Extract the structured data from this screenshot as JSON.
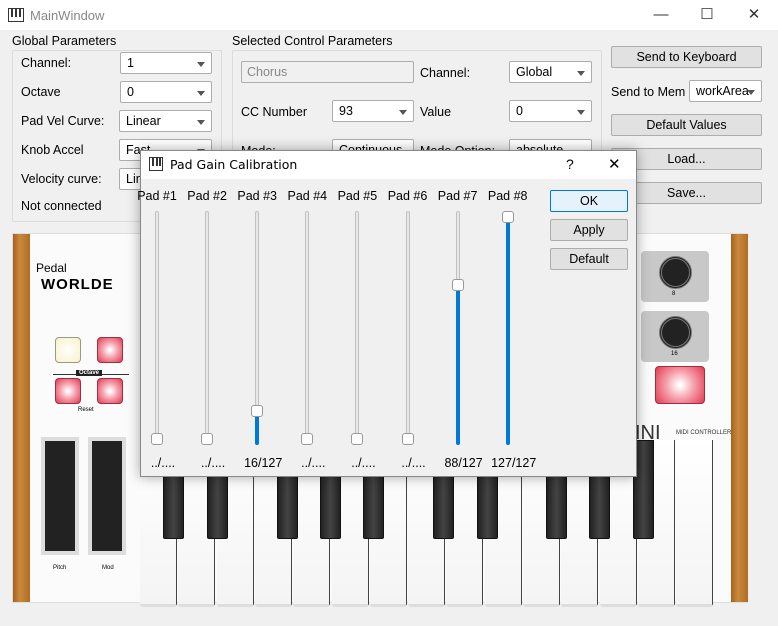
{
  "window": {
    "title": "MainWindow",
    "controls": {
      "minimize": "—",
      "maximize": "☐",
      "close": "✕"
    }
  },
  "global": {
    "title": "Global Parameters",
    "fields": [
      {
        "label": "Channel:",
        "value": "1"
      },
      {
        "label": "Octave",
        "value": "0"
      },
      {
        "label": "Pad Vel Curve:",
        "value": "Linear"
      },
      {
        "label": "Knob Accel",
        "value": "Fast"
      },
      {
        "label": "Velocity curve:",
        "value": "Linear"
      }
    ],
    "status": "Not connected"
  },
  "selected": {
    "title": "Selected Control Parameters",
    "name": "Chorus",
    "channel_label": "Channel:",
    "channel": "Global",
    "cc_label": "CC Number",
    "cc": "93",
    "value_label": "Value",
    "value": "0",
    "mode_label": "Mode:",
    "mode": "Continuous",
    "mode_option_label": "Mode Option:",
    "mode_option": "absolute"
  },
  "actions": {
    "send_keyboard": "Send to Keyboard",
    "send_mem_label": "Send to Mem",
    "send_mem": "workArea",
    "defaults": "Default Values",
    "load": "Load...",
    "save": "Save..."
  },
  "keyboard": {
    "pedal": "Pedal",
    "brand": "WORLDE",
    "octave": "Octave",
    "reset": "Reset",
    "pitch": "Pitch",
    "mod": "Mod",
    "knob8": "8",
    "knob16": "16",
    "model": "INI",
    "subtitle": "MIDI CONTROLLER"
  },
  "dialog": {
    "title": "Pad Gain Calibration",
    "help": "?",
    "close": "✕",
    "ok": "OK",
    "apply": "Apply",
    "default": "Default",
    "max": 127,
    "pads": [
      {
        "label": "Pad #1",
        "value": 0,
        "text": "../...."
      },
      {
        "label": "Pad #2",
        "value": 0,
        "text": "../...."
      },
      {
        "label": "Pad #3",
        "value": 16,
        "text": "16/127"
      },
      {
        "label": "Pad #4",
        "value": 0,
        "text": "../...."
      },
      {
        "label": "Pad #5",
        "value": 0,
        "text": "../...."
      },
      {
        "label": "Pad #6",
        "value": 0,
        "text": "../...."
      },
      {
        "label": "Pad #7",
        "value": 88,
        "text": "88/127"
      },
      {
        "label": "Pad #8",
        "value": 127,
        "text": "127/127"
      }
    ],
    "accent": "#0078d7"
  }
}
